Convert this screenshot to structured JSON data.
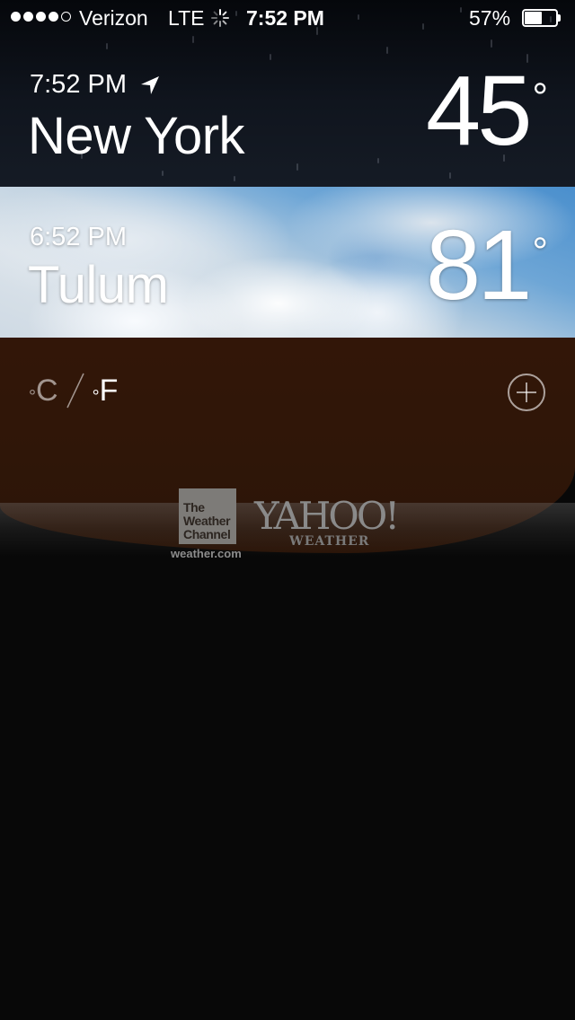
{
  "status_bar": {
    "signal": {
      "filled": 4,
      "total": 5
    },
    "carrier": "Verizon",
    "network": "LTE",
    "activity_icon": "loading-spinner-icon",
    "time": "7:52 PM",
    "battery_percent": "57%",
    "battery_level": 0.57
  },
  "cities": [
    {
      "time": "7:52 PM",
      "has_location_icon": true,
      "name": "New York",
      "temperature": "45",
      "degree_symbol": "°",
      "background": "rainy-night"
    },
    {
      "time": "6:52 PM",
      "has_location_icon": false,
      "name": "Tulum",
      "temperature": "81",
      "degree_symbol": "°",
      "background": "partly-cloudy-day"
    }
  ],
  "units": {
    "celsius": "C",
    "fahrenheit": "F",
    "degree_symbol": "°",
    "selected": "F"
  },
  "add_button_icon": "plus-circle-icon",
  "branding": {
    "twc_logo_line1": "The",
    "twc_logo_line2": "Weather",
    "twc_logo_line3": "Channel",
    "twc_domain": "weather.com",
    "yahoo_logo": "YAHOO!",
    "yahoo_sub": "WEATHER"
  },
  "colors": {
    "footer_panel": "#321608",
    "sky_blue": "#4a8fcd",
    "night": "#0b0f16",
    "background": "#080808"
  }
}
